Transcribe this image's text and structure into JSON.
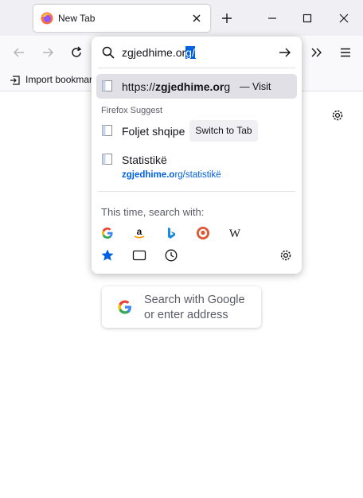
{
  "tab": {
    "title": "New Tab"
  },
  "bookmarks": {
    "import_label": "Import bookmarks…"
  },
  "urlbar": {
    "typed_text": "zgjedhime.o",
    "typed_tail": "r",
    "selected_autofill": "g/"
  },
  "results": {
    "top": {
      "url_prefix": "https://",
      "url_bold": "zgjedhime.or",
      "url_tail": "g",
      "action": "— Visit"
    },
    "section_label": "Firefox Suggest",
    "items": [
      {
        "title": "Foljet shqipe",
        "action": "Switch to Tab"
      },
      {
        "title": "Statistikë",
        "url_bold": "zgjedhime.o",
        "url_rest": "rg/statistikë"
      }
    ]
  },
  "one_off": {
    "label": "This time, search with:",
    "engines": [
      "google-icon",
      "amazon-icon",
      "bing-icon",
      "duckduckgo-icon",
      "wikipedia-icon"
    ],
    "local": [
      "bookmarks-star-icon",
      "tabs-icon",
      "history-clock-icon"
    ]
  },
  "new_tab_search": {
    "placeholder": "Search with Google or enter address"
  },
  "colors": {
    "accent": "#0061e0",
    "highlight": "#e0e0e6",
    "toolbar": "#f9f9fb"
  }
}
